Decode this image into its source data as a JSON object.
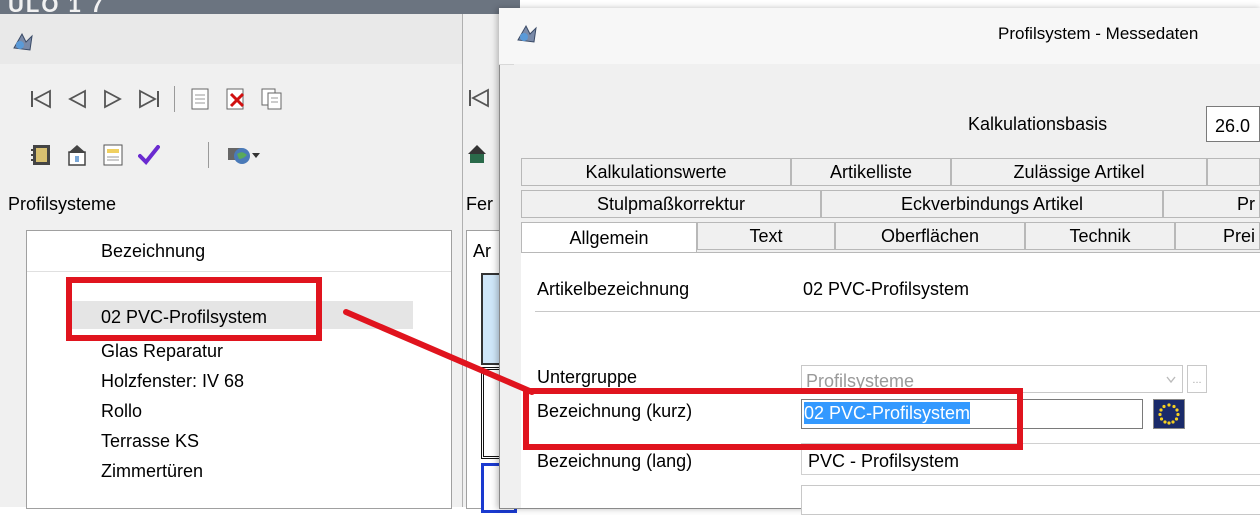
{
  "background_logo": "ULO 1 7",
  "left_window": {
    "section_label": "Profilsysteme",
    "list_header": "Bezeichnung",
    "items": [
      "02 PVC-Profilsystem",
      "Glas Reparatur",
      "Holzfenster: IV 68",
      "Rollo",
      "Terrasse KS",
      "Zimmertüren"
    ],
    "selected_index": 0
  },
  "middle_window": {
    "section_label": "Fer",
    "list_header": "Ar"
  },
  "dialog": {
    "title": "Profilsystem - Messedaten",
    "kalkulationsbasis_label": "Kalkulationsbasis",
    "kalkulationsbasis_value": "26.0",
    "tabs_row1": [
      "Kalkulationswerte",
      "Artikelliste",
      "Zulässige Artikel"
    ],
    "tabs_row2": [
      "Stulpmaßkorrektur",
      "Eckverbindungs Artikel",
      "Pr"
    ],
    "tabs_row3": [
      "Allgemein",
      "Text",
      "Oberflächen",
      "Technik",
      "Prei"
    ],
    "active_tab": "Allgemein",
    "artikelbezeichnung_label": "Artikelbezeichnung",
    "artikelbezeichnung_value": "02 PVC-Profilsystem",
    "untergruppe_label": "Untergruppe",
    "untergruppe_value": "Profilsysteme",
    "untergruppe_button": "...",
    "bez_kurz_label": "Bezeichnung (kurz)",
    "bez_kurz_value": "02 PVC-Profilsystem",
    "bez_lang_label": "Bezeichnung (lang)",
    "bez_lang_value": "PVC - Profilsystem"
  },
  "colors": {
    "highlight_red": "#e0141e",
    "selection_blue": "#3399ff"
  }
}
